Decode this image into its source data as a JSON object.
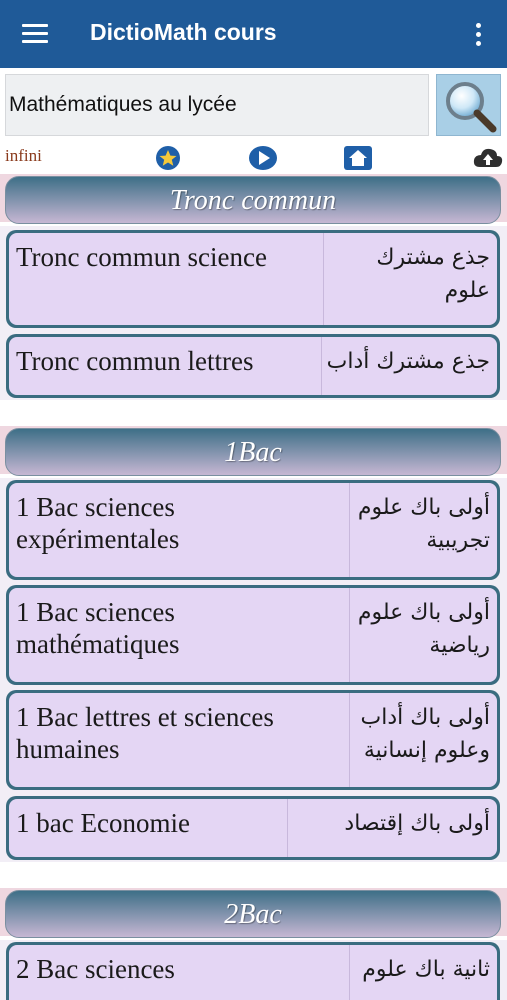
{
  "app": {
    "title": "DictioMath cours",
    "menu_icon": "hamburger-menu-icon",
    "more_icon": "more-vert-icon"
  },
  "search": {
    "value": "Mathématiques au lycée",
    "button_icon": "magnifier-icon"
  },
  "toolbar": {
    "infini_label": "infini",
    "icons": [
      "star-icon",
      "play-icon",
      "home-icon",
      "cloud-upload-icon"
    ]
  },
  "colors": {
    "appbar": "#1f5a98",
    "row_border": "#3a6c80",
    "row_fill": "#e4d6f4",
    "header_top": "#3e6f87",
    "header_bottom": "#c6b7d3"
  },
  "sections": [
    {
      "title": "Tronc commun",
      "items": [
        {
          "fr": "Tronc commun science",
          "ar": "جذع مشترك علوم"
        },
        {
          "fr": "Tronc commun lettres",
          "ar": "جذع مشترك أداب"
        }
      ]
    },
    {
      "title": "1Bac",
      "items": [
        {
          "fr": "1 Bac sciences expérimentales",
          "ar": "أولى باك علوم تجريبية"
        },
        {
          "fr": "1 Bac sciences mathématiques",
          "ar": "أولى باك علوم رياضية"
        },
        {
          "fr": "1 Bac lettres et sciences humaines",
          "ar": "أولى باك أداب وعلوم إنسانية"
        },
        {
          "fr": "1 bac Economie",
          "ar": "أولى باك إقتصاد"
        }
      ]
    },
    {
      "title": "2Bac",
      "items": [
        {
          "fr": "2 Bac sciences",
          "ar": "ثانية باك علوم"
        }
      ]
    }
  ]
}
